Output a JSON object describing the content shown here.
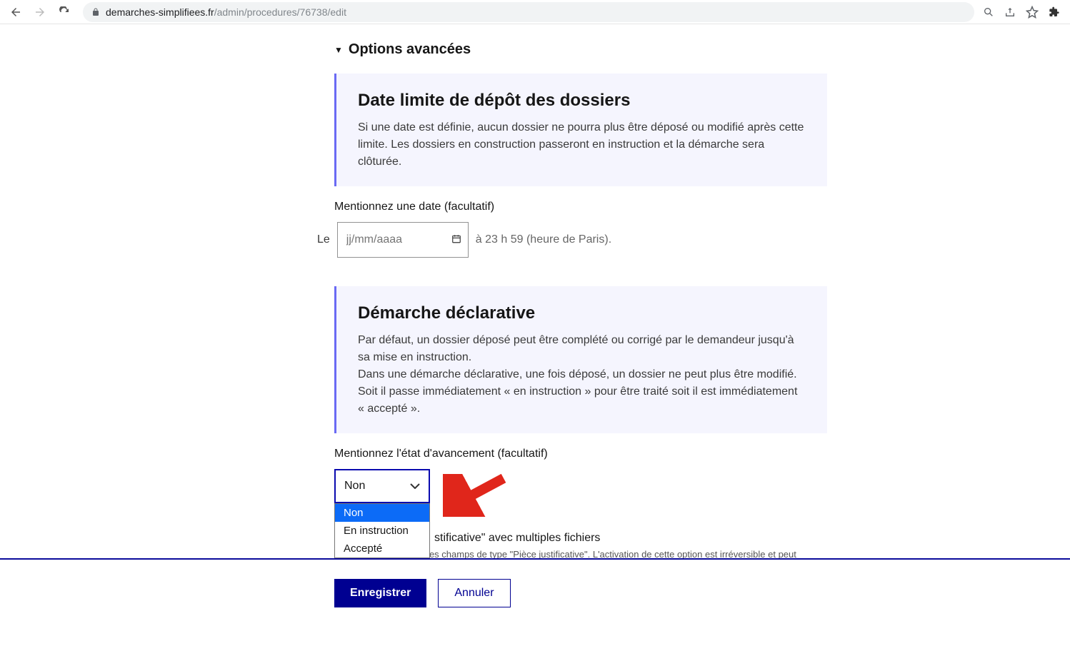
{
  "browser": {
    "domain": "demarches-simplifiees.fr",
    "path": "/admin/procedures/76738/edit"
  },
  "accordion": {
    "title": "Options avancées"
  },
  "card_deadline": {
    "title": "Date limite de dépôt des dossiers",
    "body": "Si une date est définie, aucun dossier ne pourra plus être déposé ou modifié après cette limite. Les dossiers en construction passeront en instruction et la démarche sera clôturée."
  },
  "date_field": {
    "label": "Mentionnez une date (facultatif)",
    "prefix": "Le",
    "placeholder": "jj/mm/aaaa",
    "suffix": "à 23 h 59 (heure de Paris)."
  },
  "card_declarative": {
    "title": "Démarche déclarative",
    "p1": "Par défaut, un dossier déposé peut être complété ou corrigé par le demandeur jusqu'à sa mise en instruction.",
    "p2": "Dans une démarche déclarative, une fois déposé, un dossier ne peut plus être modifié. Soit il passe immédiatement « en instruction » pour être traité soit il est immédiatement « accepté »."
  },
  "state_field": {
    "label": "Mentionnez l'état d'avancement (facultatif)",
    "selected": "Non",
    "options": {
      "0": "Non",
      "1": "En instruction",
      "2": "Accepté"
    }
  },
  "multi_files": {
    "line": "stificative\" avec multiples fichiers",
    "help": "plusieurs fichiers pour les champs de type \"Pièce justificative\". L'activation de cette option est irréversible et peut nécessiter des modifications si vous utilisez des systèmes automatisés pour traiter les dossiers."
  },
  "footer": {
    "save": "Enregistrer",
    "cancel": "Annuler"
  }
}
